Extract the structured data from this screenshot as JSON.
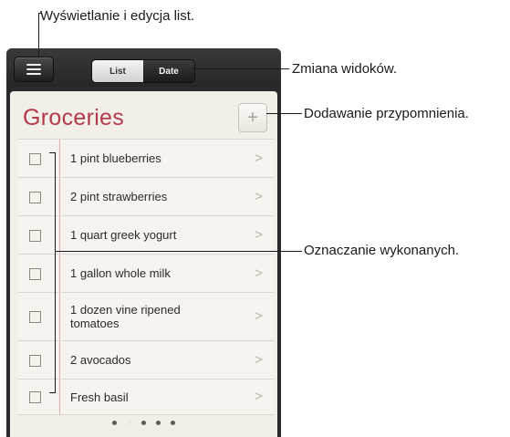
{
  "toolbar": {
    "menu_icon": "menu-icon",
    "segments": [
      "List",
      "Date"
    ],
    "selected_segment": "List"
  },
  "list": {
    "title": "Groceries",
    "add_icon": "plus-icon",
    "title_color": "#b23a4b",
    "items": [
      {
        "text": "1 pint blueberries",
        "checked": false
      },
      {
        "text": "2 pint strawberries",
        "checked": false
      },
      {
        "text": "1 quart greek yogurt",
        "checked": false
      },
      {
        "text": "1 gallon whole milk",
        "checked": false
      },
      {
        "text": "1 dozen vine ripened tomatoes",
        "checked": false
      },
      {
        "text": "2 avocados",
        "checked": false
      },
      {
        "text": "Fresh basil",
        "checked": false
      }
    ]
  },
  "pager": {
    "page_count": 5,
    "current_page": 2
  },
  "callouts": {
    "view_lists": "Wyświetlanie i edycja list.",
    "change_view": "Zmiana widoków.",
    "add_reminder": "Dodawanie przypomnienia.",
    "mark_done": "Oznaczanie wykonanych."
  }
}
